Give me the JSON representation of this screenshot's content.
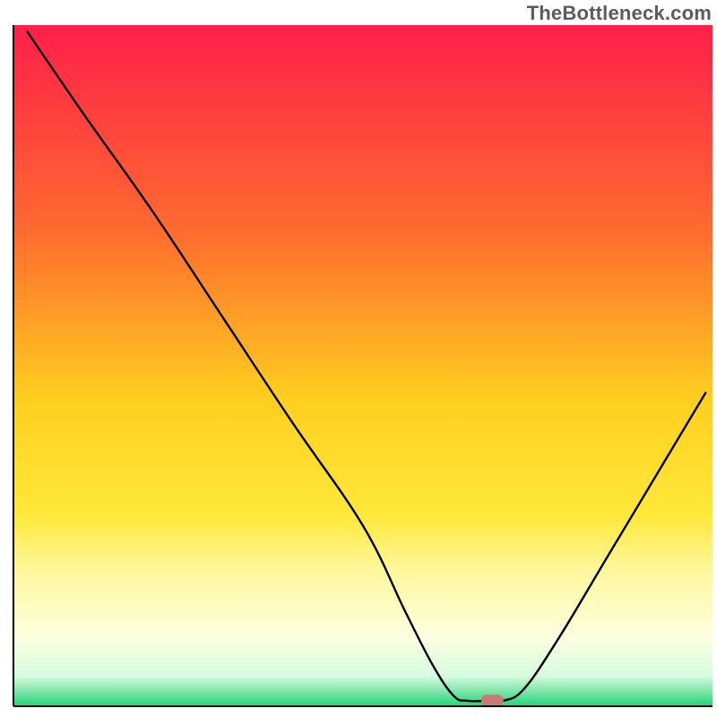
{
  "watermark": "TheBottleneck.com",
  "chart_data": {
    "type": "line",
    "title": "",
    "xlabel": "",
    "ylabel": "",
    "xlim": [
      0,
      100
    ],
    "ylim": [
      0,
      100
    ],
    "grid": false,
    "legend": false,
    "annotations": [],
    "background_gradient": {
      "stops": [
        {
          "offset": 0.0,
          "color": "#ff1f4b"
        },
        {
          "offset": 0.3,
          "color": "#ff6a2f"
        },
        {
          "offset": 0.55,
          "color": "#ffcf1f"
        },
        {
          "offset": 0.72,
          "color": "#ffe93a"
        },
        {
          "offset": 0.8,
          "color": "#fff79c"
        },
        {
          "offset": 0.9,
          "color": "#fcffe0"
        },
        {
          "offset": 0.955,
          "color": "#d7fce0"
        },
        {
          "offset": 0.975,
          "color": "#8ce7b0"
        },
        {
          "offset": 1.0,
          "color": "#1ed679"
        }
      ]
    },
    "series": [
      {
        "name": "bottleneck-curve",
        "color": "#000000",
        "points": [
          {
            "x": 2.0,
            "y": 99.0
          },
          {
            "x": 10.0,
            "y": 87.0
          },
          {
            "x": 20.0,
            "y": 72.5
          },
          {
            "x": 30.0,
            "y": 57.0
          },
          {
            "x": 40.0,
            "y": 41.5
          },
          {
            "x": 50.0,
            "y": 26.5
          },
          {
            "x": 56.0,
            "y": 14.0
          },
          {
            "x": 60.0,
            "y": 6.0
          },
          {
            "x": 63.0,
            "y": 1.5
          },
          {
            "x": 65.0,
            "y": 0.8
          },
          {
            "x": 68.0,
            "y": 0.8
          },
          {
            "x": 70.0,
            "y": 0.8
          },
          {
            "x": 73.0,
            "y": 2.5
          },
          {
            "x": 78.0,
            "y": 10.0
          },
          {
            "x": 85.0,
            "y": 22.0
          },
          {
            "x": 92.0,
            "y": 34.0
          },
          {
            "x": 99.0,
            "y": 46.0
          }
        ]
      }
    ],
    "marker": {
      "name": "optimal-point",
      "x": 68.5,
      "y": 0.9,
      "color": "#c97a74",
      "width": 3.2,
      "height": 1.6
    }
  }
}
